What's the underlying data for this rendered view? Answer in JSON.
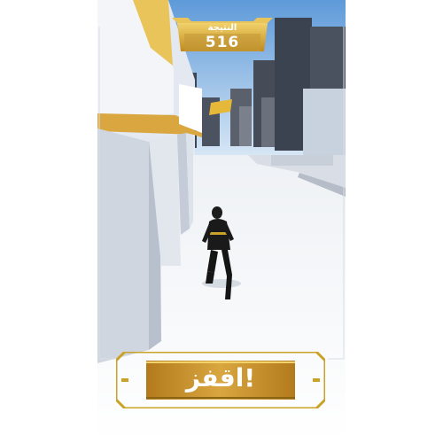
{
  "hud": {
    "score_label": "النتيجة",
    "score_value": "516"
  },
  "controls": {
    "jump_label": "اقفز!"
  },
  "colors": {
    "gold": "#c9a227",
    "gold_light": "#f2d26b",
    "gold_dark": "#8a6512",
    "sky": "#7fb3e6",
    "floor": "#f7f8fa"
  },
  "icons": {
    "hero": "black-suited-runner",
    "billboard": "yellow-billboard"
  }
}
